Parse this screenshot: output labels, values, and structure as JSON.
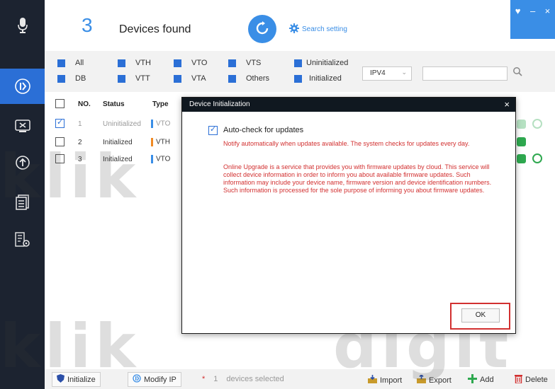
{
  "header": {
    "device_count": "3",
    "found_label": "Devices found",
    "search_setting_label": "Search setting",
    "window_controls": [
      "♥",
      "–",
      "×"
    ]
  },
  "sidebar": {
    "icons": [
      "microphone-icon",
      "logo-icon",
      "tools-icon",
      "upgrade-icon",
      "document-icon",
      "config-icon"
    ],
    "active_color": "#2b6fd6"
  },
  "filters": {
    "row1": [
      "All",
      "VTH",
      "VTO",
      "VTS",
      "Uninitialized"
    ],
    "row2": [
      "DB",
      "VTT",
      "VTA",
      "Others",
      "Initialized"
    ],
    "ip_version": "IPV4",
    "search_value": ""
  },
  "table": {
    "headers": [
      "NO.",
      "Status",
      "Type"
    ],
    "rows": [
      {
        "no": "1",
        "status": "Uninitialized",
        "type": "VTO",
        "checked": true
      },
      {
        "no": "2",
        "status": "Initialized",
        "type": "VTH",
        "checked": false
      },
      {
        "no": "3",
        "status": "Initialized",
        "type": "VTO",
        "checked": false
      }
    ]
  },
  "dialog": {
    "title": "Device Initialization",
    "close_glyph": "×",
    "auto_check_label": "Auto-check for updates",
    "notify_text": "Notify automatically when updates available. The system checks for updates every day.",
    "online_text": "Online Upgrade is a service that provides you with firmware updates by cloud. This service will collect device information in order to inform you about available firmware updates. Such information may include your device name, firmware version and device identification numbers. Such information is processed for the sole purpose of informing you about firmware updates.",
    "ok_label": "OK"
  },
  "footer": {
    "initialize_label": "Initialize",
    "modify_ip_label": "Modify IP",
    "selected_count": "1",
    "selected_label": "devices selected",
    "import_label": "Import",
    "export_label": "Export",
    "add_label": "Add",
    "delete_label": "Delete"
  },
  "colors": {
    "accent": "#3a8ee6",
    "warning_text": "#d23030",
    "sidebar_bg": "#1c2330"
  }
}
